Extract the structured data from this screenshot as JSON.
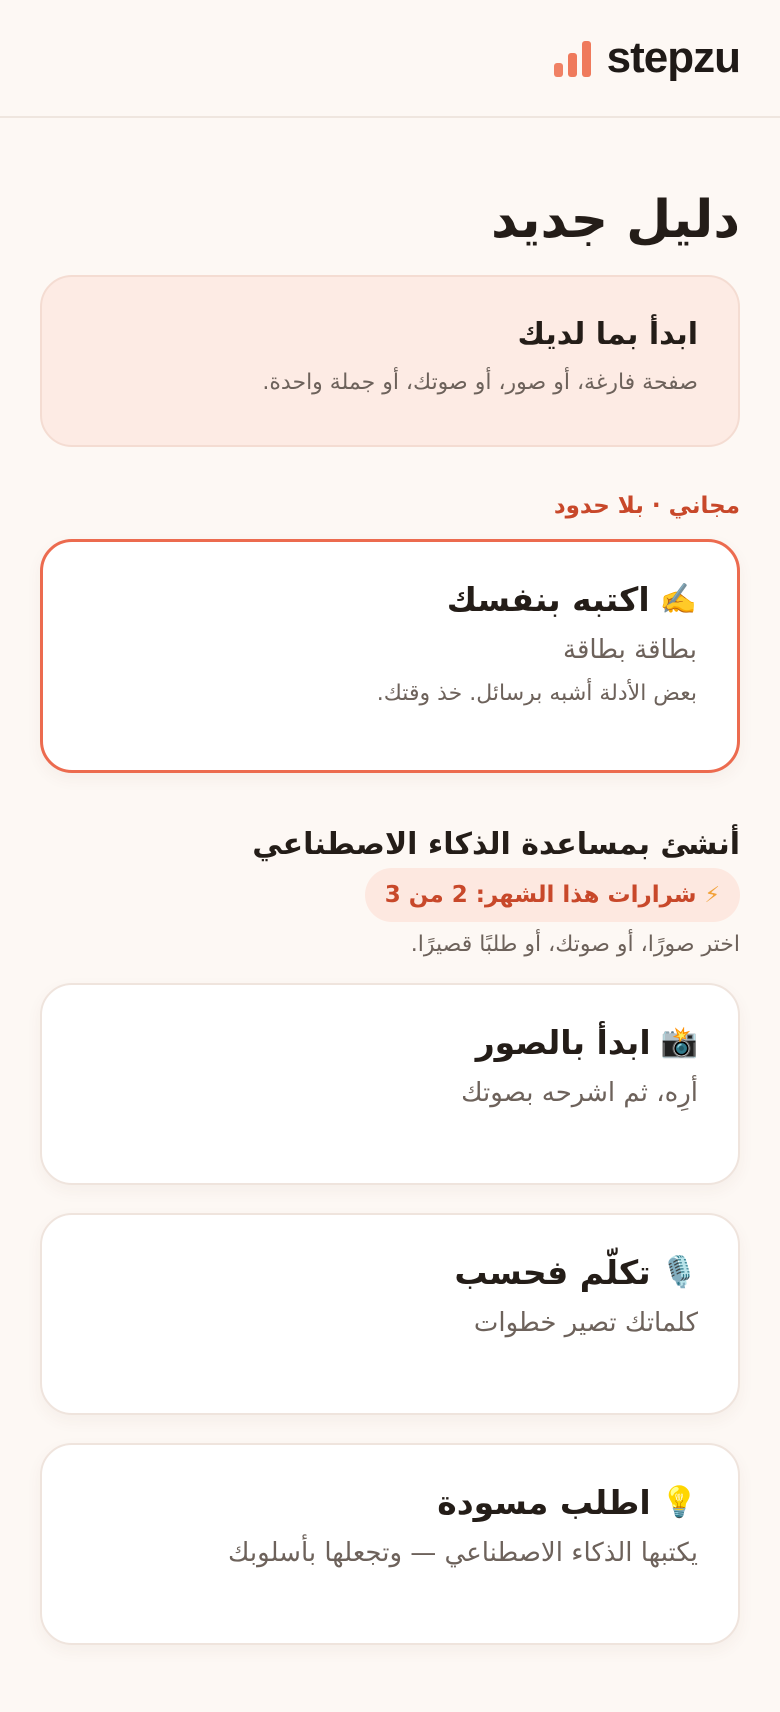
{
  "header": {
    "brand_name": "stepzu",
    "brand_icon": "bar-chart-icon",
    "accent_color": "#ef7a5c"
  },
  "page": {
    "title": "دليل جديد"
  },
  "intro": {
    "title": "ابدأ بما لديك",
    "subtitle": "صفحة فارغة، أو صور، أو صوتك، أو جملة واحدة."
  },
  "free_section": {
    "label": "مجاني · بلا حدود",
    "card": {
      "emoji": "✍️",
      "title": "اكتبه بنفسك",
      "subtitle": "بطاقة بطاقة",
      "note": "بعض الأدلة أشبه برسائل. خذ وقتك.",
      "selected": true
    }
  },
  "ai_section": {
    "title": "أنشئ بمساعدة الذكاء الاصطناعي",
    "credits_icon": "⚡",
    "credits_text": "شرارات هذا الشهر: 2 من 3",
    "subtitle": "اختر صورًا، أو صوتك، أو طلبًا قصيرًا.",
    "cards": [
      {
        "emoji": "📸",
        "icon_name": "camera-flash-icon",
        "title": "ابدأ بالصور",
        "subtitle": "أرِه، ثم اشرحه بصوتك"
      },
      {
        "emoji": "🎙️",
        "icon_name": "microphone-icon",
        "title": "تكلّم فحسب",
        "subtitle": "كلماتك تصير خطوات"
      },
      {
        "emoji": "💡",
        "icon_name": "lightbulb-icon",
        "title": "اطلب مسودة",
        "subtitle": "يكتبها الذكاء الاصطناعي — وتجعلها بأسلوبك"
      }
    ]
  }
}
